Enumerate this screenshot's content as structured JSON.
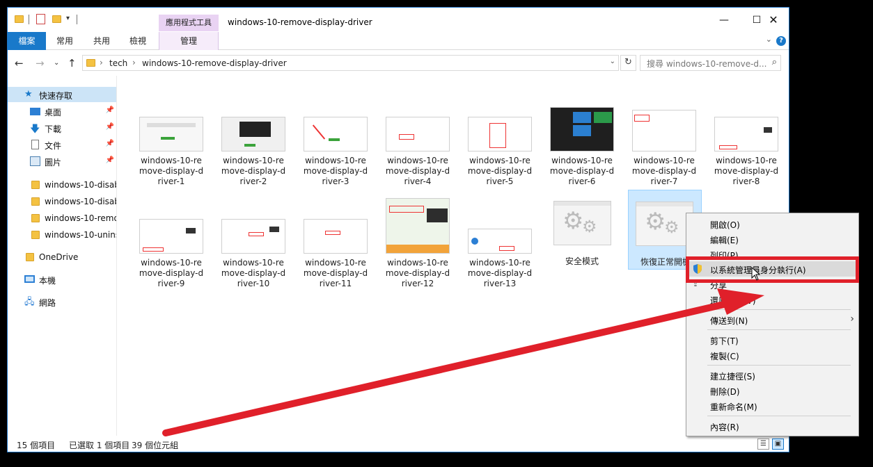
{
  "window": {
    "title": "windows-10-remove-display-driver",
    "context_tab_header": "應用程式工具"
  },
  "ribbon": {
    "tabs": [
      "檔案",
      "常用",
      "共用",
      "檢視",
      "管理"
    ]
  },
  "address": {
    "crumbs": [
      "tech",
      "windows-10-remove-display-driver"
    ],
    "search_placeholder": "搜尋 windows-10-remove-d..."
  },
  "nav": {
    "quick_access": "快速存取",
    "pinned": [
      {
        "label": "桌面",
        "icon": "desktop-icon"
      },
      {
        "label": "下載",
        "icon": "download-icon"
      },
      {
        "label": "文件",
        "icon": "document-icon"
      },
      {
        "label": "圖片",
        "icon": "pictures-icon"
      }
    ],
    "folders": [
      "windows-10-disab",
      "windows-10-disab",
      "windows-10-remo",
      "windows-10-unins"
    ],
    "onedrive": "OneDrive",
    "this_pc": "本機",
    "network": "網路"
  },
  "files": [
    {
      "lines": [
        "windows-10-re",
        "move-display-d",
        "river-1"
      ]
    },
    {
      "lines": [
        "windows-10-re",
        "move-display-d",
        "river-2"
      ]
    },
    {
      "lines": [
        "windows-10-re",
        "move-display-d",
        "river-3"
      ]
    },
    {
      "lines": [
        "windows-10-re",
        "move-display-d",
        "river-4"
      ]
    },
    {
      "lines": [
        "windows-10-re",
        "move-display-d",
        "river-5"
      ]
    },
    {
      "lines": [
        "windows-10-re",
        "move-display-d",
        "river-6"
      ]
    },
    {
      "lines": [
        "windows-10-re",
        "move-display-d",
        "river-7"
      ]
    },
    {
      "lines": [
        "windows-10-re",
        "move-display-d",
        "river-8"
      ]
    },
    {
      "lines": [
        "windows-10-re",
        "move-display-d",
        "river-9"
      ]
    },
    {
      "lines": [
        "windows-10-re",
        "move-display-d",
        "river-10"
      ]
    },
    {
      "lines": [
        "windows-10-re",
        "move-display-d",
        "river-11"
      ]
    },
    {
      "lines": [
        "windows-10-re",
        "move-display-d",
        "river-12"
      ]
    },
    {
      "lines": [
        "windows-10-re",
        "move-display-d",
        "river-13"
      ]
    },
    {
      "lines": [
        "安全模式"
      ]
    },
    {
      "lines": [
        "恢復正常開機"
      ]
    }
  ],
  "status": {
    "count": "15 個項目",
    "selected": "已選取 1 個項目",
    "size": "39 個位元組"
  },
  "context_menu": {
    "open": "開啟(O)",
    "edit": "編輯(E)",
    "print": "列印(P)",
    "run_as_admin": "以系統管理員身分執行(A)",
    "share": "分享",
    "restore": "還原舊版(V)",
    "send_to": "傳送到(N)",
    "cut": "剪下(T)",
    "copy": "複製(C)",
    "create_shortcut": "建立捷徑(S)",
    "delete": "刪除(D)",
    "rename": "重新命名(M)",
    "properties": "內容(R)"
  },
  "colors": {
    "accent": "#1979ca",
    "annotation_red": "#e0202a",
    "selection": "#cce8ff"
  }
}
